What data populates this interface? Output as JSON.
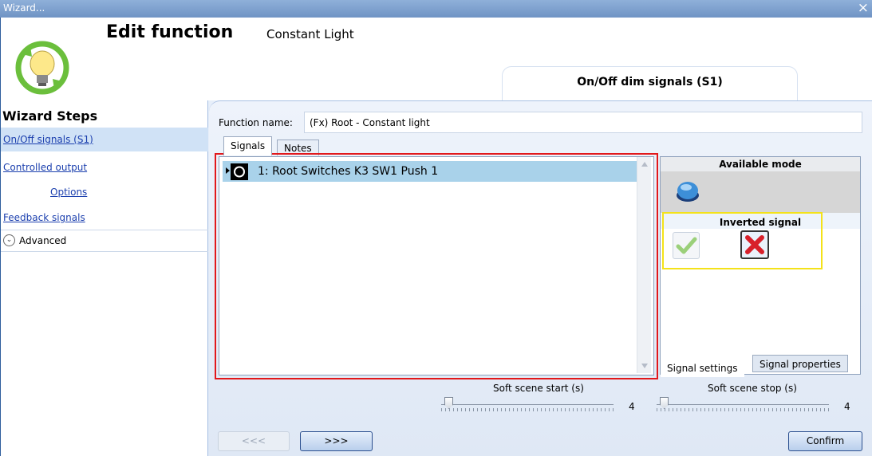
{
  "window": {
    "title": "Wizard...",
    "close_symbol": "×"
  },
  "header": {
    "title": "Edit function",
    "subtitle": "Constant Light",
    "tab_label": "On/Off dim signals (S1)"
  },
  "sidebar": {
    "title": "Wizard Steps",
    "items": [
      {
        "label": "On/Off signals (S1)",
        "active": true
      },
      {
        "label": "Controlled output"
      },
      {
        "label": "Options"
      },
      {
        "label": "Feedback signals"
      }
    ],
    "advanced_label": "Advanced"
  },
  "function": {
    "name_label": "Function name:",
    "name_value": "(Fx) Root - Constant light"
  },
  "tabs": {
    "signals": "Signals",
    "notes": "Notes"
  },
  "signals_list": [
    {
      "label": "1: Root Switches K3 SW1 Push 1",
      "icon": "push-button-icon"
    }
  ],
  "right_panel": {
    "available_mode": "Available mode",
    "mode_icon": "blue-push-button-icon",
    "inverted_signal": "Inverted signal",
    "check_icon": "check-icon",
    "cross_icon": "cross-icon",
    "tab_settings": "Signal settings",
    "tab_properties": "Signal properties"
  },
  "sliders": {
    "start": {
      "label": "Soft scene start (s)",
      "value": "4",
      "level": 0.03
    },
    "stop": {
      "label": "Soft scene stop (s)",
      "value": "4",
      "level": 0.03
    }
  },
  "buttons": {
    "prev": "<<<",
    "next": ">>>",
    "confirm": "Confirm"
  },
  "colors": {
    "highlight_red": "#e2181b",
    "highlight_yellow": "#f4e21a",
    "selected_row": "#a9d2ea",
    "link": "#1b3fae"
  }
}
